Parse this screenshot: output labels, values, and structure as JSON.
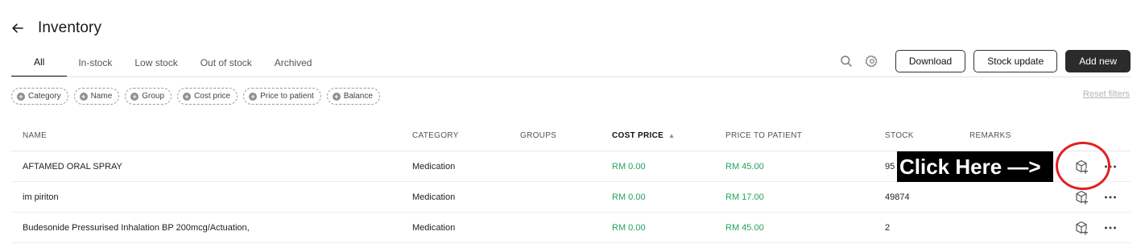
{
  "header": {
    "title": "Inventory",
    "back_icon": "arrow-left-icon"
  },
  "tabs": [
    {
      "label": "All",
      "active": true
    },
    {
      "label": "In-stock",
      "active": false
    },
    {
      "label": "Low stock",
      "active": false
    },
    {
      "label": "Out of stock",
      "active": false
    },
    {
      "label": "Archived",
      "active": false
    }
  ],
  "toolbar": {
    "search_icon": "search-icon",
    "settings_icon": "gear-icon",
    "download_label": "Download",
    "stock_update_label": "Stock update",
    "add_new_label": "Add new"
  },
  "filters": {
    "chips": [
      "Category",
      "Name",
      "Group",
      "Cost price",
      "Price to patient",
      "Balance"
    ],
    "reset_label": "Reset filters"
  },
  "table": {
    "columns": {
      "name": "NAME",
      "category": "CATEGORY",
      "groups": "GROUPS",
      "cost_price": "COST PRICE",
      "price_to_patient": "PRICE TO PATIENT",
      "stock": "STOCK",
      "remarks": "REMARKS"
    },
    "sort": {
      "column": "cost_price",
      "direction": "ascending"
    },
    "rows": [
      {
        "name": "AFTAMED ORAL SPRAY",
        "category": "Medication",
        "groups": "",
        "cost_price": "RM 0.00",
        "price_to_patient": "RM 45.00",
        "stock": "95",
        "remarks": ""
      },
      {
        "name": "im piriton",
        "category": "Medication",
        "groups": "",
        "cost_price": "RM 0.00",
        "price_to_patient": "RM 17.00",
        "stock": "49874",
        "remarks": ""
      },
      {
        "name": "Budesonide Pressurised Inhalation BP 200mcg/Actuation,",
        "category": "Medication",
        "groups": "",
        "cost_price": "RM 0.00",
        "price_to_patient": "RM 45.00",
        "stock": "2",
        "remarks": ""
      }
    ],
    "row_action_icon": "package-plus-icon",
    "row_more_icon": "more-horizontal-icon"
  },
  "annotation": {
    "text": "Click Here —>",
    "highlight_color": "#e02020"
  },
  "colors": {
    "accent_dark": "#2b2b2b",
    "price_green": "#22a35a"
  }
}
